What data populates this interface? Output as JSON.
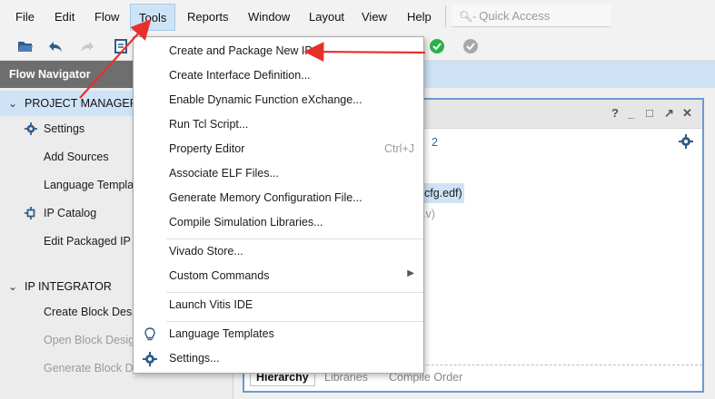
{
  "menubar": {
    "items": [
      "File",
      "Edit",
      "Flow",
      "Tools",
      "Reports",
      "Window",
      "Layout",
      "View",
      "Help"
    ],
    "quick_access_placeholder": "Quick Access"
  },
  "toolbar": {
    "icons": [
      "open-folder-icon",
      "undo-icon",
      "redo-icon",
      "document-icon",
      "checkmark-green-icon",
      "checkmark-gray-icon"
    ]
  },
  "flow_navigator": {
    "title": "Flow Navigator",
    "project_manager": {
      "title": "PROJECT MANAGER",
      "items": [
        "Settings",
        "Add Sources",
        "Language Templa",
        "IP Catalog",
        "Edit Packaged IP"
      ]
    },
    "ip_integrator": {
      "title": "IP INTEGRATOR",
      "items": [
        "Create Block Des",
        "Open Block Desig",
        "Generate Block D"
      ]
    }
  },
  "main_panel": {
    "window_controls": [
      "?",
      "_",
      "□",
      "↗",
      "✕"
    ],
    "tab_number": "2",
    "highlighted_file": "cfg.edf)",
    "secondary_text": ".v)",
    "tabs": [
      "Hierarchy",
      "Libraries",
      "Compile Order"
    ]
  },
  "tools_menu": {
    "items": [
      {
        "label": "Create and Package New IP...",
        "shortcut": ""
      },
      {
        "label": "Create Interface Definition...",
        "shortcut": ""
      },
      {
        "label": "Enable Dynamic Function eXchange...",
        "shortcut": ""
      },
      {
        "label": "Run Tcl Script...",
        "shortcut": ""
      },
      {
        "label": "Property Editor",
        "shortcut": "Ctrl+J"
      },
      {
        "label": "Associate ELF Files...",
        "shortcut": ""
      },
      {
        "label": "Generate Memory Configuration File...",
        "shortcut": ""
      },
      {
        "label": "Compile Simulation Libraries...",
        "shortcut": ""
      },
      {
        "label": "Vivado Store...",
        "shortcut": ""
      },
      {
        "label": "Custom Commands",
        "shortcut": ""
      },
      {
        "label": "Launch Vitis IDE",
        "shortcut": ""
      },
      {
        "label": "Language Templates",
        "shortcut": ""
      },
      {
        "label": "Settings...",
        "shortcut": ""
      }
    ]
  },
  "colors": {
    "accent_blue": "#cde2f5",
    "panel_border": "#6b9ad1",
    "annotation_red": "#e8302b",
    "check_green": "#2ab24a"
  }
}
